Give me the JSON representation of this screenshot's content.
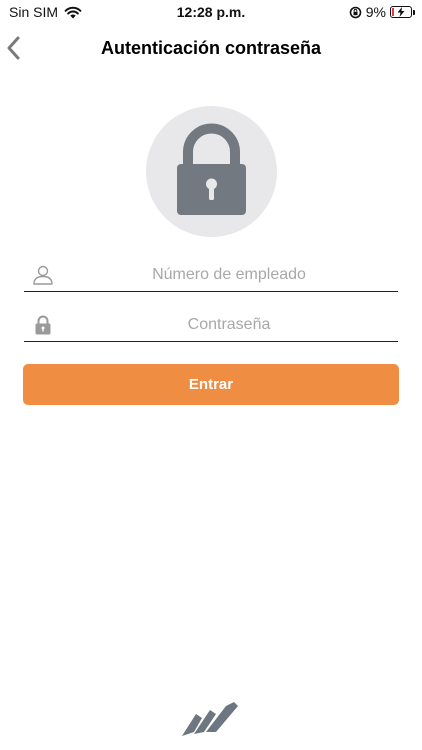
{
  "status_bar": {
    "carrier": "Sin SIM",
    "time": "12:28 p.m.",
    "battery_percent": "9%",
    "icons": [
      "wifi-icon",
      "orientation-lock-icon",
      "battery-charging-icon"
    ]
  },
  "nav": {
    "title": "Autenticación contraseña",
    "back_icon": "chevron-left-icon"
  },
  "lock_badge": {
    "icon": "padlock-icon"
  },
  "form": {
    "employee_number": {
      "placeholder": "Número de empleado",
      "value": "",
      "icon": "user-icon"
    },
    "password": {
      "placeholder": "Contraseña",
      "value": "",
      "icon": "lock-icon"
    },
    "submit_label": "Entrar"
  },
  "colors": {
    "accent": "#EF8E42",
    "lock_gray": "#737980",
    "badge_bg": "#E8E8EA",
    "logo_gray": "#6E7681"
  },
  "footer": {
    "logo_icon": "brand-logo-icon"
  }
}
